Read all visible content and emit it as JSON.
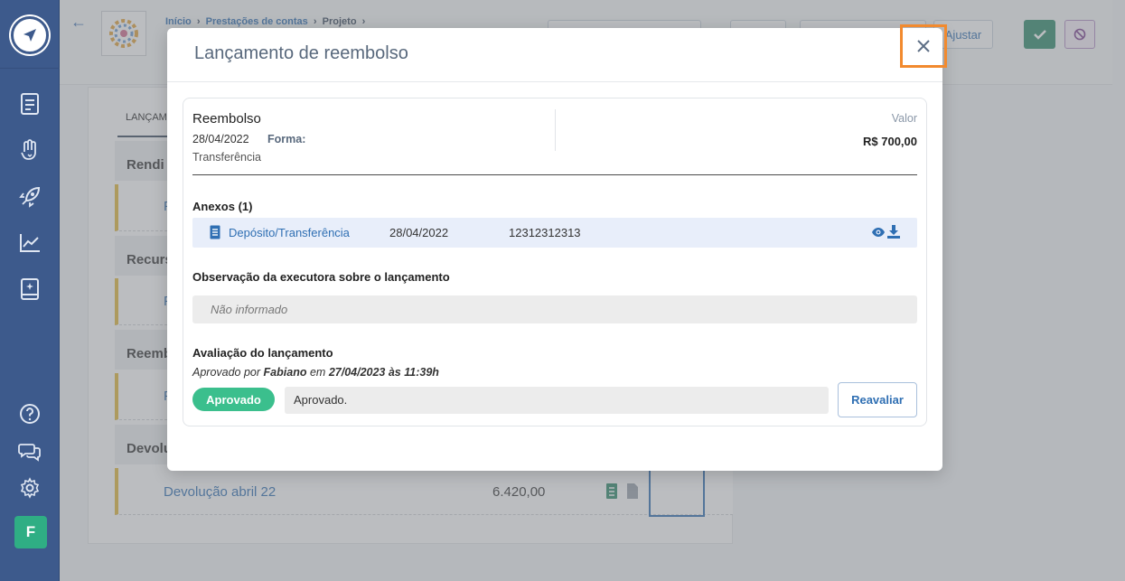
{
  "breadcrumb": {
    "home": "Início",
    "accounts": "Prestações de contas",
    "project": "Projeto"
  },
  "header": {
    "ajustar_label": "Ajustar"
  },
  "background": {
    "tab_label": "LANÇAM",
    "sections": [
      "Rendi",
      "Recurs",
      "Reemb",
      "Devolu"
    ],
    "row_links": [
      "F",
      "F",
      "F"
    ],
    "devolucao": {
      "label": "Devolução abril 22",
      "value": "6.420,00"
    }
  },
  "sidebar": {
    "avatar_letter": "F"
  },
  "modal": {
    "title": "Lançamento de reembolso",
    "entry": {
      "type": "Reembolso",
      "date": "28/04/2022",
      "forma_label": "Forma:",
      "method": "Transferência",
      "value_label": "Valor",
      "value": "R$ 700,00"
    },
    "attachments": {
      "heading": "Anexos (1)",
      "items": [
        {
          "name": "Depósito/Transferência",
          "date": "28/04/2022",
          "number": "12312312313"
        }
      ]
    },
    "observation": {
      "heading": "Observação da executora sobre o lançamento",
      "text": "Não informado"
    },
    "evaluation": {
      "heading": "Avaliação do lançamento",
      "prefix": "Aprovado por",
      "by": "Fabiano",
      "mid": "em",
      "when": "27/04/2023 às 11:39h",
      "status": "Aprovado",
      "comment": "Aprovado.",
      "reevaluate_label": "Reavaliar"
    }
  },
  "colors": {
    "sidebar": "#3d5a8c",
    "approved": "#3bbf8d",
    "link": "#2f6fb3",
    "close_highlight": "#f28a2e"
  }
}
